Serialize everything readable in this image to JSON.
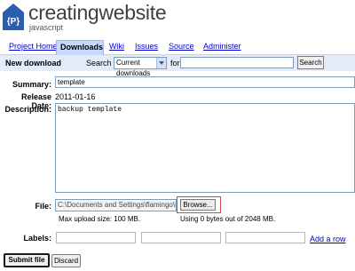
{
  "header": {
    "title": "creatingwebsite",
    "subtitle": "javascript",
    "logo_letter": "{P}"
  },
  "tabs": [
    {
      "label": "Project Home",
      "active": false
    },
    {
      "label": "Downloads",
      "active": true
    },
    {
      "label": "Wiki",
      "active": false
    },
    {
      "label": "Issues",
      "active": false
    },
    {
      "label": "Source",
      "active": false
    },
    {
      "label": "Administer",
      "active": false
    }
  ],
  "searchbar": {
    "new_download": "New download",
    "search_label": "Search",
    "search_select": "Current downloads",
    "for_label": "for",
    "search_button": "Search"
  },
  "form": {
    "summary_label": "Summary:",
    "summary_value": "template",
    "release_label": "Release Date:",
    "release_value": "2011-01-16",
    "description_label": "Description:",
    "description_value": "backup template",
    "file_label": "File:",
    "file_value": "C:\\Documents and Settings\\flamingo\\M",
    "browse_button": "Browse...",
    "max_upload": "Max upload size: 100 MB.",
    "usage": "Using 0 bytes out of 2048 MB.",
    "labels_label": "Labels:",
    "add_row": "Add a row",
    "submit_button": "Submit file",
    "discard_button": "Discard"
  },
  "colors": {
    "tab_active_bg": "#c3d9ff",
    "searchbar_bg": "#e5ecf9",
    "logo_blue": "#2a5db0",
    "link": "#0000cc",
    "highlight_ring": "#d24a4a"
  }
}
